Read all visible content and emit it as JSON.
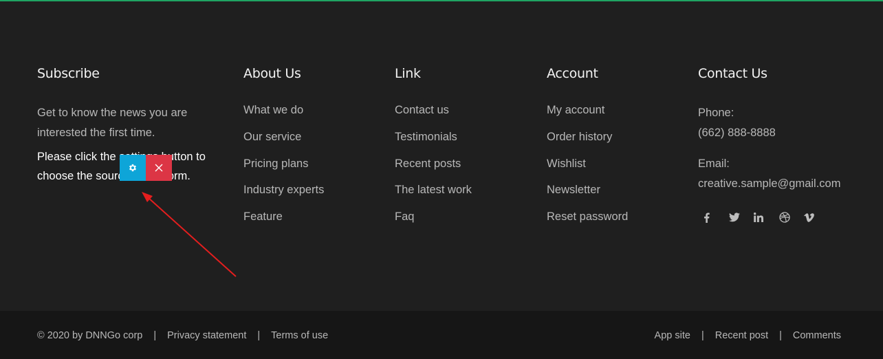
{
  "subscribe": {
    "title": "Subscribe",
    "description": "Get to know the news you are interested the first time.",
    "note": "Please click the settings button to choose the source of the form."
  },
  "about": {
    "title": "About Us",
    "items": [
      "What we do",
      "Our service",
      "Pricing plans",
      "Industry experts",
      "Feature"
    ]
  },
  "link": {
    "title": "Link",
    "items": [
      "Contact us",
      "Testimonials",
      "Recent posts",
      "The latest work",
      "Faq"
    ]
  },
  "account": {
    "title": "Account",
    "items": [
      "My account",
      "Order history",
      "Wishlist",
      "Newsletter",
      "Reset password"
    ]
  },
  "contact": {
    "title": "Contact Us",
    "phone_label": "Phone:",
    "phone": "(662) 888-8888",
    "email_label": "Email:",
    "email": "creative.sample@gmail.com",
    "social_icons": [
      "facebook-icon",
      "twitter-icon",
      "linkedin-icon",
      "dribbble-icon",
      "vimeo-icon"
    ]
  },
  "bottom": {
    "copyright": "© 2020 by DNNGo corp",
    "privacy": "Privacy statement",
    "terms": "Terms of use",
    "app_site": "App site",
    "recent_post": "Recent post",
    "comments": "Comments",
    "separator": "|"
  },
  "colors": {
    "accent_line": "#1fa463",
    "settings_button": "#0ea5d8",
    "close_button": "#dc3545",
    "arrow": "#e41e1e",
    "footer_bg": "#1f1f1f",
    "bottom_bg": "#161616"
  }
}
